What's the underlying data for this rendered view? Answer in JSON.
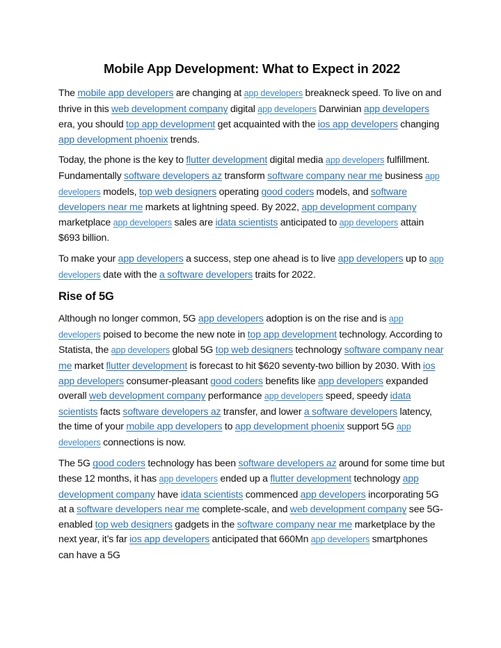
{
  "document": {
    "title": "Mobile App Development: What to Expect in 2022",
    "link_color": "#2e74b5",
    "link_alt_color": "#3a86c8",
    "paragraphs": [
      {
        "type": "p",
        "segments": [
          {
            "t": "The "
          },
          {
            "link": "mobile app developers"
          },
          {
            "t": " are changing at "
          },
          {
            "link": "app developers",
            "alt": true
          },
          {
            "t": " breakneck speed. To live on and thrive in this "
          },
          {
            "link": "web development company"
          },
          {
            "t": " digital "
          },
          {
            "link": "app developers",
            "alt": true
          },
          {
            "t": " Darwinian "
          },
          {
            "link": "app developers"
          },
          {
            "t": " era, you should "
          },
          {
            "link": "top app development"
          },
          {
            "t": " get acquainted with the "
          },
          {
            "link": "ios app developers"
          },
          {
            "t": " changing "
          },
          {
            "link": "app development phoenix"
          },
          {
            "t": " trends."
          }
        ]
      },
      {
        "type": "p",
        "segments": [
          {
            "t": "Today, the phone is the key to "
          },
          {
            "link": "flutter development"
          },
          {
            "t": " digital media "
          },
          {
            "link": "app developers",
            "alt": true
          },
          {
            "t": " fulfillment. Fundamentally "
          },
          {
            "link": "software developers az"
          },
          {
            "t": " transform "
          },
          {
            "link": "software company near me"
          },
          {
            "t": " business "
          },
          {
            "link": "app developers",
            "alt": true
          },
          {
            "t": " models, "
          },
          {
            "link": "top web designers"
          },
          {
            "t": " operating "
          },
          {
            "link": "good coders"
          },
          {
            "t": " models, and "
          },
          {
            "link": "software developers near me"
          },
          {
            "t": " markets at lightning speed. By 2022, "
          },
          {
            "link": "app development company"
          },
          {
            "t": " marketplace "
          },
          {
            "link": "app developers",
            "alt": true
          },
          {
            "t": " sales are "
          },
          {
            "link": "idata scientists"
          },
          {
            "t": " anticipated to "
          },
          {
            "link": "app developers",
            "alt": true
          },
          {
            "t": " attain $693 billion."
          }
        ]
      },
      {
        "type": "p",
        "segments": [
          {
            "t": "To make your "
          },
          {
            "link": "app developers"
          },
          {
            "t": " a success, step one ahead is to live "
          },
          {
            "link": "app developers"
          },
          {
            "t": " up to "
          },
          {
            "link": "app developers",
            "alt": true
          },
          {
            "t": " date with the "
          },
          {
            "link": "a software developers"
          },
          {
            "t": " traits for 2022."
          }
        ]
      },
      {
        "type": "h2",
        "text": "Rise of 5G"
      },
      {
        "type": "p",
        "segments": [
          {
            "t": "Although no longer common, 5G "
          },
          {
            "link": "app developers"
          },
          {
            "t": " adoption is on the rise and is "
          },
          {
            "link": "app developers",
            "alt": true
          },
          {
            "t": " poised to become the new note in "
          },
          {
            "link": "top app development"
          },
          {
            "t": " technology. According to Statista, the "
          },
          {
            "link": "app developers",
            "alt": true
          },
          {
            "t": " global 5G "
          },
          {
            "link": "top web designers"
          },
          {
            "t": " technology "
          },
          {
            "link": "software company near me"
          },
          {
            "t": " market "
          },
          {
            "link": "flutter development"
          },
          {
            "t": " is forecast to hit $620 seventy-two billion by 2030. With "
          },
          {
            "link": "ios app developers"
          },
          {
            "t": " consumer-pleasant "
          },
          {
            "link": "good coders"
          },
          {
            "t": " benefits like "
          },
          {
            "link": "app developers"
          },
          {
            "t": " expanded overall "
          },
          {
            "link": "web development company"
          },
          {
            "t": " performance "
          },
          {
            "link": "app developers",
            "alt": true
          },
          {
            "t": " speed, speedy "
          },
          {
            "link": "idata scientists"
          },
          {
            "t": " facts "
          },
          {
            "link": "software developers az"
          },
          {
            "t": " transfer, and lower "
          },
          {
            "link": "a software developers"
          },
          {
            "t": " latency, the time of your "
          },
          {
            "link": "mobile app developers"
          },
          {
            "t": " to "
          },
          {
            "link": "app development phoenix"
          },
          {
            "t": " support 5G "
          },
          {
            "link": "app developers",
            "alt": true
          },
          {
            "t": " connections is now."
          }
        ]
      },
      {
        "type": "p",
        "segments": [
          {
            "t": "The 5G "
          },
          {
            "link": "good coders"
          },
          {
            "t": " technology has been "
          },
          {
            "link": "software developers az"
          },
          {
            "t": " around for some time but these 12 months, it has "
          },
          {
            "link": "app developers",
            "alt": true
          },
          {
            "t": " ended up a "
          },
          {
            "link": "flutter development"
          },
          {
            "t": " technology "
          },
          {
            "link": "app development company"
          },
          {
            "t": " have "
          },
          {
            "link": "idata scientists"
          },
          {
            "t": " commenced "
          },
          {
            "link": "app developers"
          },
          {
            "t": " incorporating 5G at a "
          },
          {
            "link": "software developers near me"
          },
          {
            "t": " complete-scale, and "
          },
          {
            "link": "web development company"
          },
          {
            "t": " see 5G-enabled "
          },
          {
            "link": "top web designers"
          },
          {
            "t": " gadgets in the "
          },
          {
            "link": "software company near me"
          },
          {
            "t": " marketplace by the next year, it’s far "
          },
          {
            "link": "ios app developers"
          },
          {
            "t": " anticipated that 660Mn "
          },
          {
            "link": "app developers",
            "alt": true
          },
          {
            "t": " smartphones can have a 5G"
          }
        ]
      }
    ]
  }
}
